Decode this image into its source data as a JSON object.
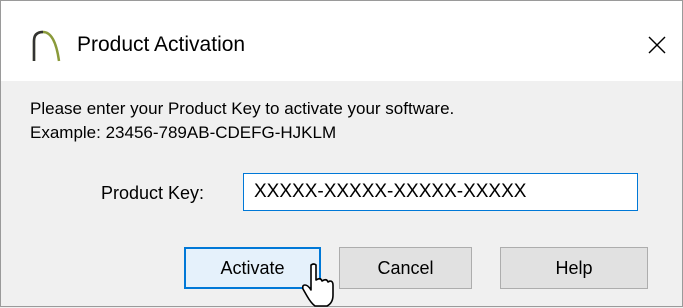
{
  "window": {
    "title": "Product Activation",
    "close_glyph": "✕"
  },
  "message": {
    "line1": "Please enter your Product Key to activate your software.",
    "line2": "Example: 23456-789AB-CDEFG-HJKLM"
  },
  "form": {
    "key_label": "Product Key:",
    "key_value": "XXXXX-XXXXX-XXXXX-XXXXX"
  },
  "buttons": {
    "activate": "Activate",
    "cancel": "Cancel",
    "help": "Help"
  },
  "icons": {
    "app": "app-logo-arch-icon",
    "close": "close-icon",
    "cursor": "pointer-hand-cursor-icon"
  },
  "colors": {
    "accent": "#0078d7",
    "logo": "#8a9a3a",
    "button_bg": "#e1e1e1",
    "window_bg": "#f0f0f0"
  }
}
